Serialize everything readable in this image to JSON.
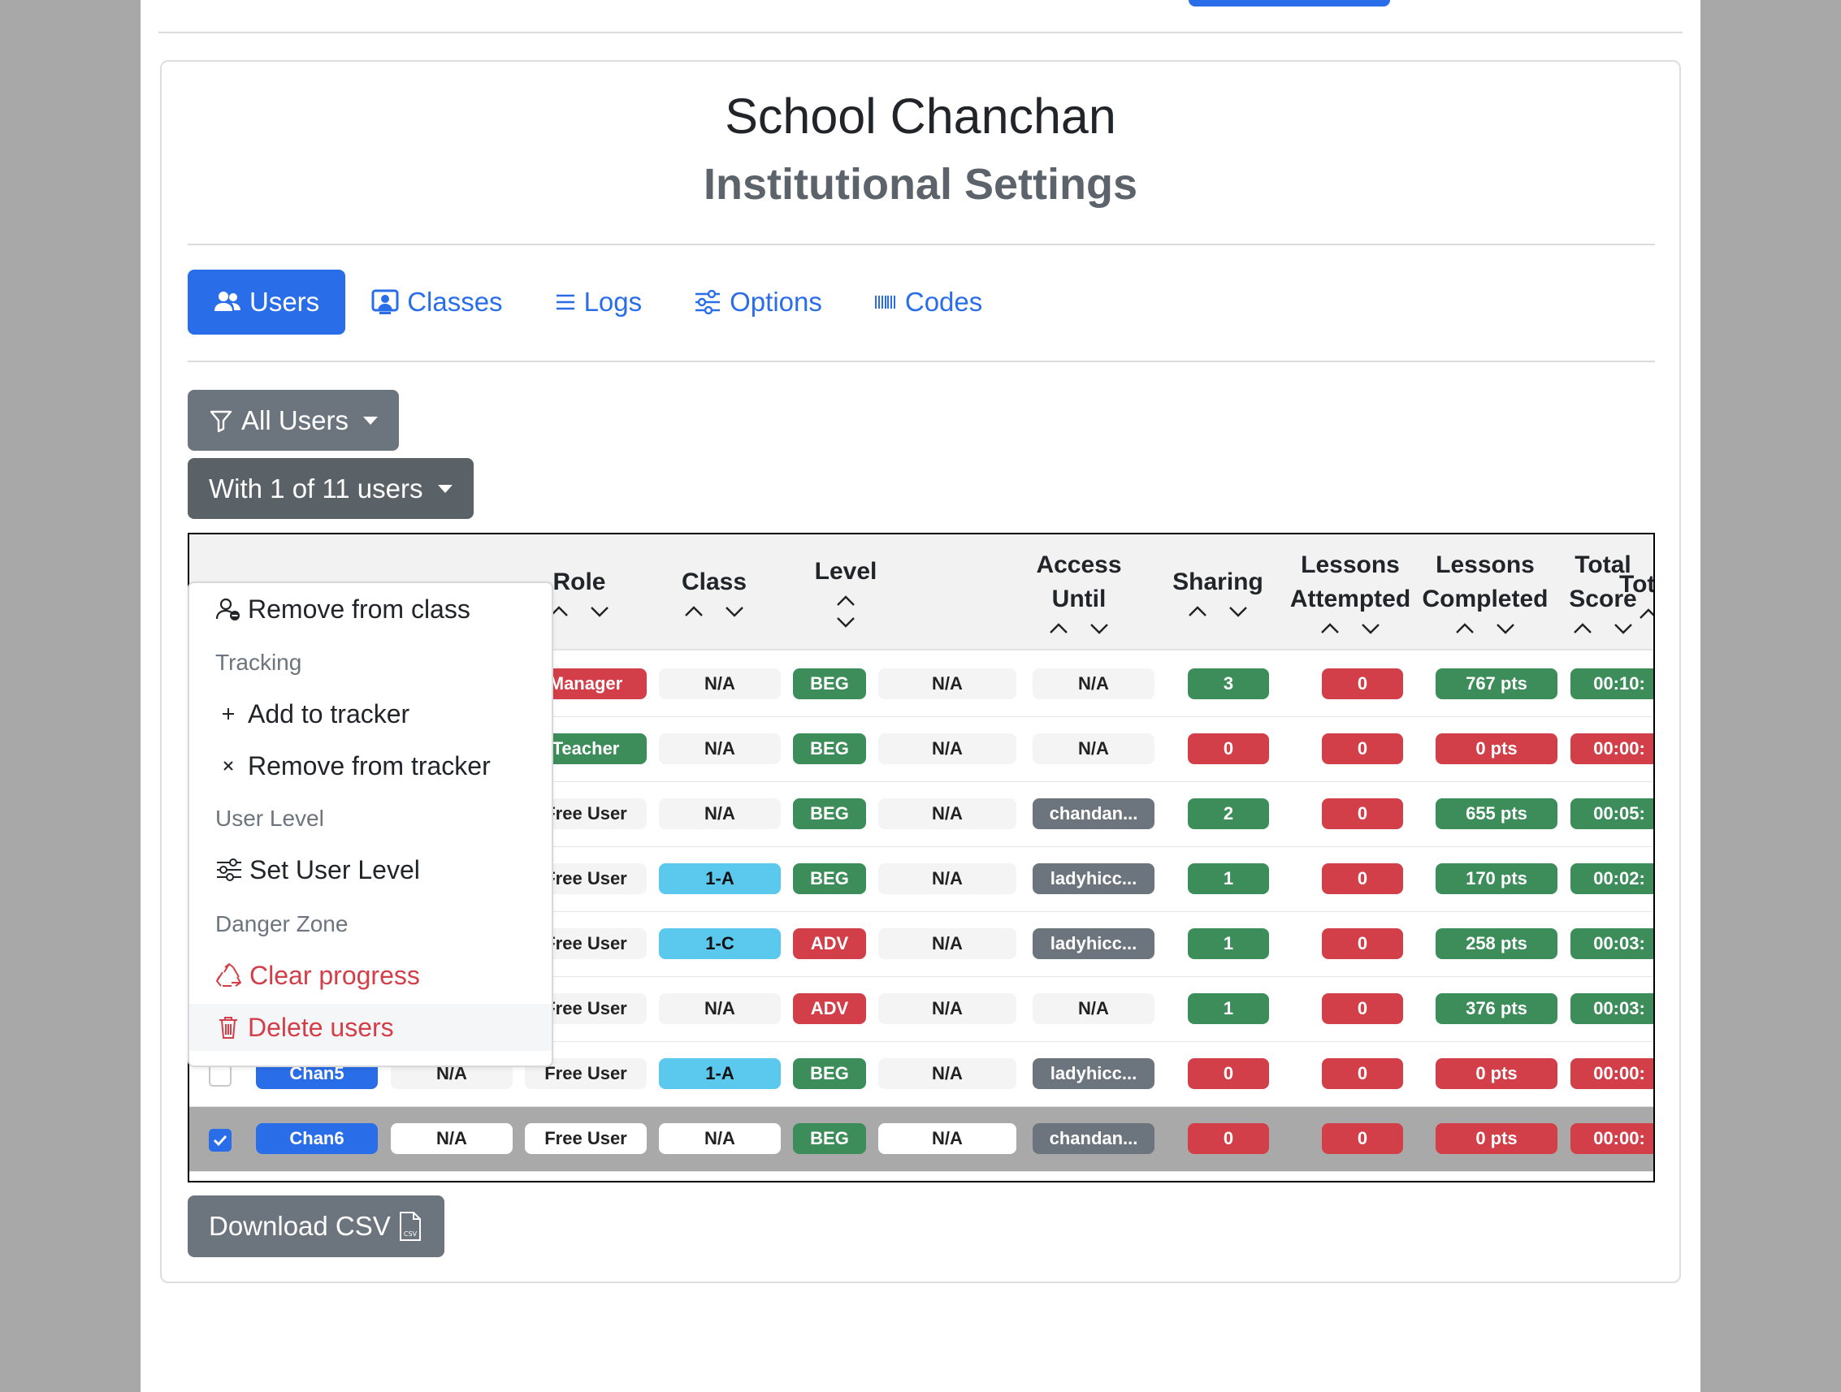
{
  "header": {
    "title": "School Chanchan",
    "subtitle": "Institutional Settings"
  },
  "tabs": [
    {
      "label": "Users",
      "icon": "users-icon",
      "active": true
    },
    {
      "label": "Classes",
      "icon": "person-badge-icon"
    },
    {
      "label": "Logs",
      "icon": "list-icon"
    },
    {
      "label": "Options",
      "icon": "sliders-icon"
    },
    {
      "label": "Codes",
      "icon": "barcode-icon"
    }
  ],
  "filter": {
    "label": "All Users"
  },
  "bulk_actions": {
    "label": "With 1 of 11 users"
  },
  "dropdown": {
    "remove_from_class": "Remove from class",
    "tracking_header": "Tracking",
    "add_to_tracker": "Add to tracker",
    "remove_from_tracker": "Remove from tracker",
    "user_level_header": "User Level",
    "set_user_level": "Set User Level",
    "danger_header": "Danger Zone",
    "clear_progress": "Clear progress",
    "delete_users": "Delete users"
  },
  "table": {
    "headers": {
      "role": "Role",
      "class": "Class",
      "level": "Level",
      "access_1": "Access",
      "access_2": "Until",
      "sharing": "Sharing",
      "attempted_1": "Lessons",
      "attempted_2": "Attempted",
      "completed_1": "Lessons",
      "completed_2": "Completed",
      "score_1": "Total",
      "score_2": "Score",
      "time": "Total Ti"
    },
    "rows": [
      {
        "role": "Manager",
        "class": "N/A",
        "level": "BEG",
        "access": "N/A",
        "sharing": "N/A",
        "attempted": "3",
        "completed": "0",
        "score": "767 pts",
        "time": "00:10:"
      },
      {
        "role": "Teacher",
        "class": "N/A",
        "level": "BEG",
        "access": "N/A",
        "sharing": "N/A",
        "attempted": "0",
        "completed": "0",
        "score": "0 pts",
        "time": "00:00:"
      },
      {
        "role": "Free User",
        "class": "N/A",
        "level": "BEG",
        "access": "N/A",
        "sharing": "chandan...",
        "attempted": "2",
        "completed": "0",
        "score": "655 pts",
        "time": "00:05:"
      },
      {
        "role": "Free User",
        "class": "1-A",
        "level": "BEG",
        "access": "N/A",
        "sharing": "ladyhicc...",
        "attempted": "1",
        "completed": "0",
        "score": "170 pts",
        "time": "00:02:"
      },
      {
        "role": "Free User",
        "class": "1-C",
        "level": "ADV",
        "access": "N/A",
        "sharing": "ladyhicc...",
        "attempted": "1",
        "completed": "0",
        "score": "258 pts",
        "time": "00:03:"
      },
      {
        "role": "Free User",
        "class": "N/A",
        "level": "ADV",
        "access": "N/A",
        "sharing": "N/A",
        "attempted": "1",
        "completed": "0",
        "score": "376 pts",
        "time": "00:03:"
      },
      {
        "name": "Chan5",
        "email": "N/A",
        "role": "Free User",
        "class": "1-A",
        "level": "BEG",
        "access": "N/A",
        "sharing": "ladyhicc...",
        "attempted": "0",
        "completed": "0",
        "score": "0 pts",
        "time": "00:00:"
      },
      {
        "name": "Chan6",
        "email": "N/A",
        "role": "Free User",
        "class": "N/A",
        "level": "BEG",
        "access": "N/A",
        "sharing": "chandan...",
        "attempted": "0",
        "completed": "0",
        "score": "0 pts",
        "time": "00:00:"
      }
    ]
  },
  "download": {
    "label": "Download CSV"
  },
  "colors": {
    "primary": "#2a6de8",
    "success": "#3c8d5a",
    "danger": "#d33f49",
    "info": "#5bc8ee",
    "secondary": "#6c757d"
  }
}
